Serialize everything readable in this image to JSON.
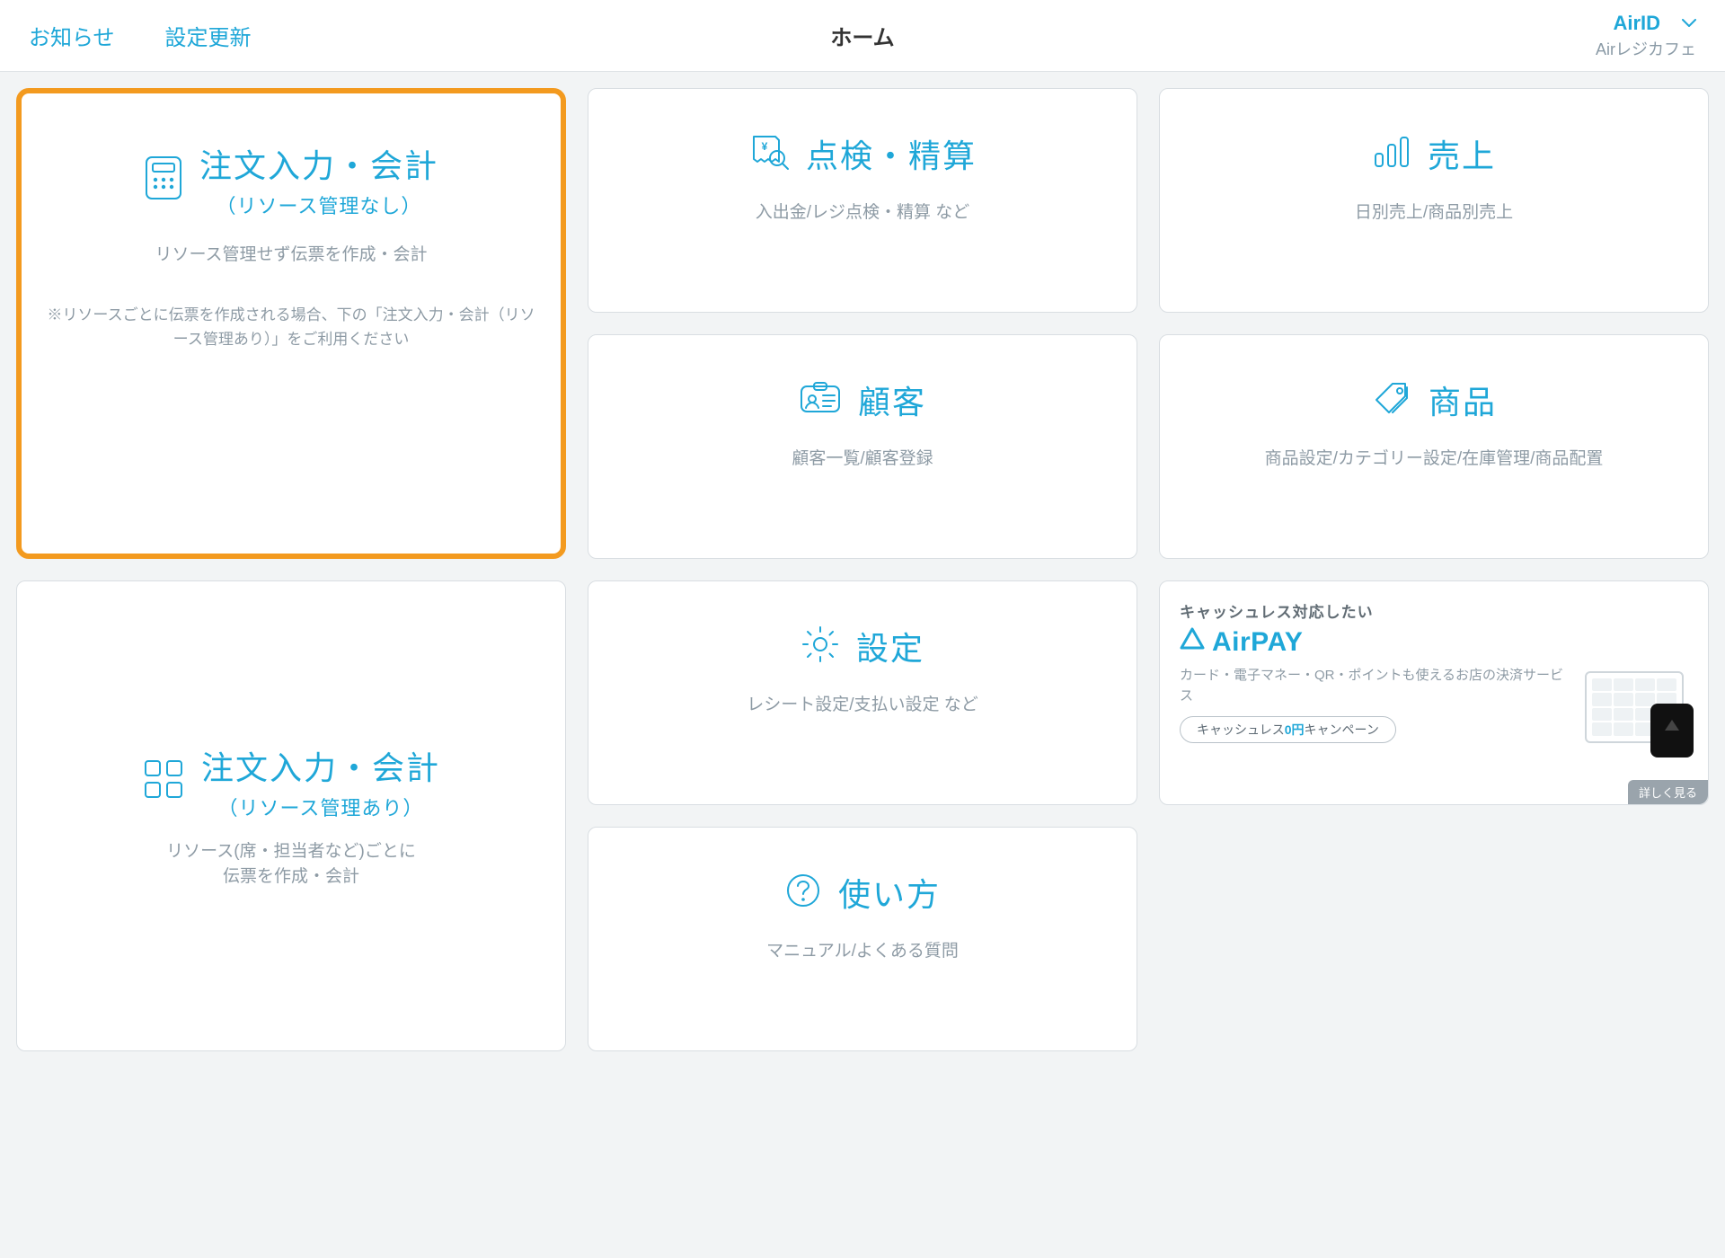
{
  "header": {
    "notice": "お知らせ",
    "settings_update": "設定更新",
    "title": "ホーム",
    "airid": "AirID",
    "store": "Airレジカフェ"
  },
  "cards": {
    "order_no_res": {
      "title": "注文入力・会計",
      "subtitle": "（リソース管理なし）",
      "desc": "リソース管理せず伝票を作成・会計",
      "note": "※リソースごとに伝票を作成される場合、下の「注文入力・会計（リソース管理あり）」をご利用ください"
    },
    "order_with_res": {
      "title": "注文入力・会計",
      "subtitle": "（リソース管理あり）",
      "desc": "リソース(席・担当者など)ごとに\n伝票を作成・会計"
    },
    "inspect": {
      "title": "点検・精算",
      "desc": "入出金/レジ点検・精算 など"
    },
    "customer": {
      "title": "顧客",
      "desc": "顧客一覧/顧客登録"
    },
    "settings": {
      "title": "設定",
      "desc": "レシート設定/支払い設定 など"
    },
    "howto": {
      "title": "使い方",
      "desc": "マニュアル/よくある質問"
    },
    "sales": {
      "title": "売上",
      "desc": "日別売上/商品別売上"
    },
    "product": {
      "title": "商品",
      "desc": "商品設定/カテゴリー設定/在庫管理/商品配置"
    }
  },
  "promo": {
    "lead": "キャッシュレス対応したい",
    "brand": "AirPAY",
    "sub": "カード・電子マネー・QR・ポイントも使えるお店の決済サービス",
    "pill_prefix": "キャッシュレス",
    "pill_zero": "0円",
    "pill_suffix": "キャンペーン",
    "more": "詳しく見る"
  }
}
